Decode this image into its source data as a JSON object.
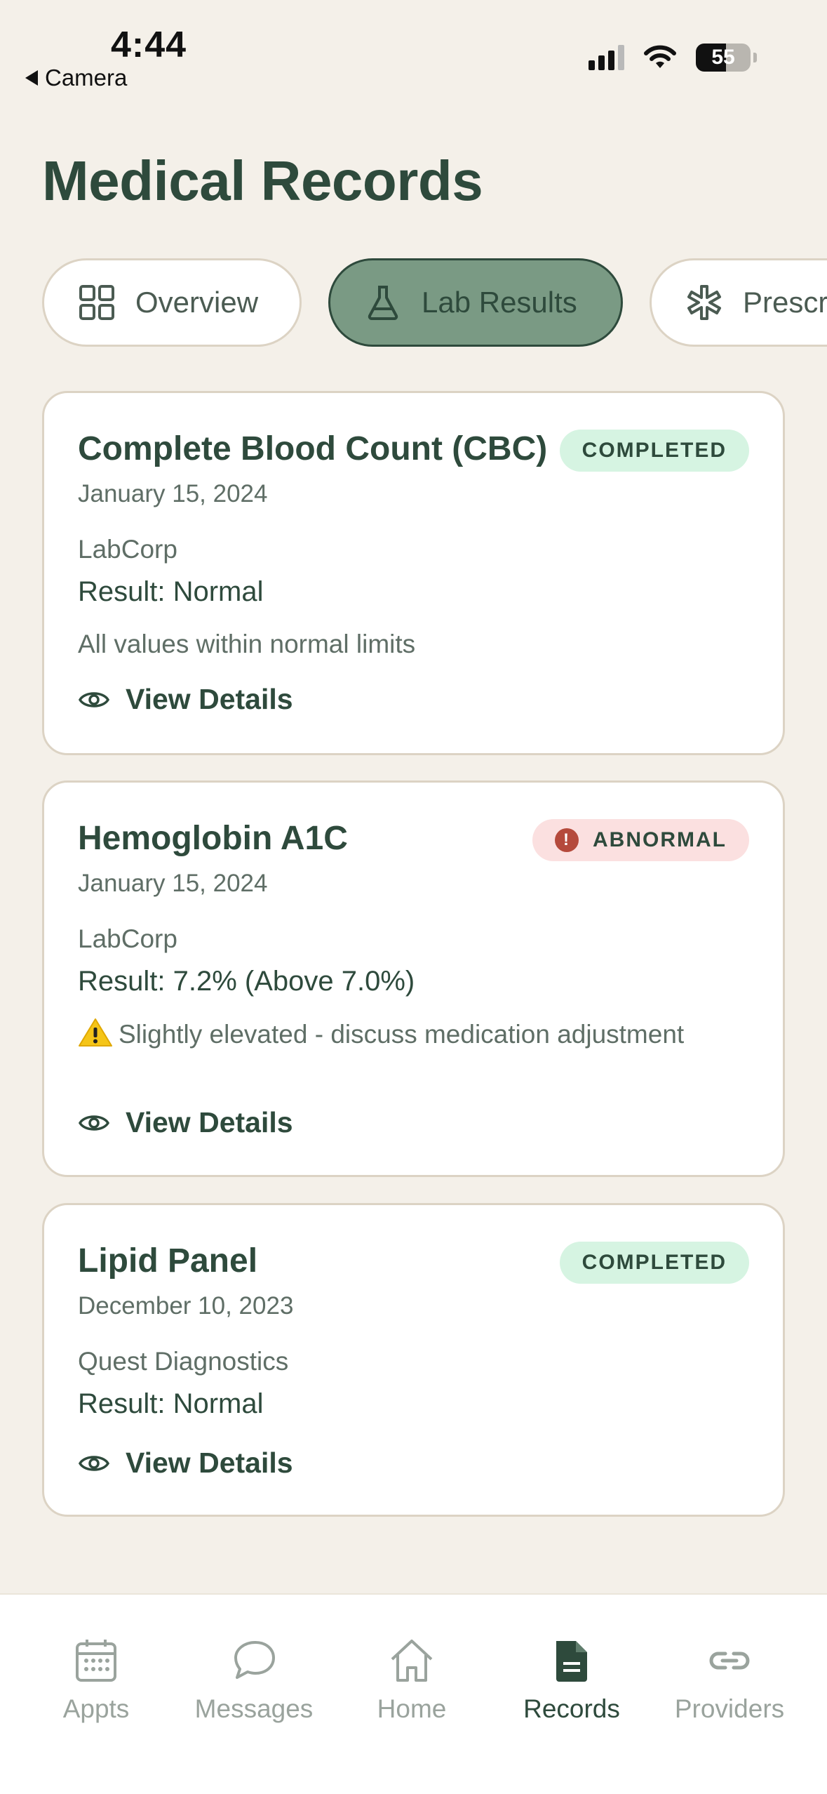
{
  "status_bar": {
    "time": "4:44",
    "back_label": "Camera",
    "battery": "55"
  },
  "page": {
    "title": "Medical Records"
  },
  "tabs": [
    {
      "label": "Overview",
      "icon": "grid-icon",
      "active": false
    },
    {
      "label": "Lab Results",
      "icon": "flask-icon",
      "active": true
    },
    {
      "label": "Prescriptions",
      "icon": "medical-star-icon",
      "active": false
    }
  ],
  "records": [
    {
      "title": "Complete Blood Count (CBC)",
      "date": "January 15, 2024",
      "lab": "LabCorp",
      "result": "Result: Normal",
      "note": "All values within normal limits",
      "status": "COMPLETED",
      "action": "View Details"
    },
    {
      "title": "Hemoglobin A1C",
      "date": "January 15, 2024",
      "lab": "LabCorp",
      "result": "Result: 7.2% (Above 7.0%)",
      "note": "Slightly elevated - discuss medication adjustment",
      "status": "ABNORMAL",
      "action": "View Details"
    },
    {
      "title": "Lipid Panel",
      "date": "December 10, 2023",
      "lab": "Quest Diagnostics",
      "result": "Result: Normal",
      "status": "COMPLETED",
      "action": "View Details"
    }
  ],
  "nav": [
    {
      "label": "Appts",
      "icon": "calendar-icon"
    },
    {
      "label": "Messages",
      "icon": "chat-bubble-icon"
    },
    {
      "label": "Home",
      "icon": "home-icon"
    },
    {
      "label": "Records",
      "icon": "document-icon",
      "active": true
    },
    {
      "label": "Providers",
      "icon": "link-icon"
    }
  ],
  "colors": {
    "background": "#f4f0e9",
    "primary_text": "#2e4a3c",
    "active_tab": "#7a9a84",
    "completed_badge": "#d6f4e2",
    "abnormal_badge": "#fbe0e0",
    "alert": "#b54a3c",
    "inactive_nav": "#9aa39d"
  }
}
